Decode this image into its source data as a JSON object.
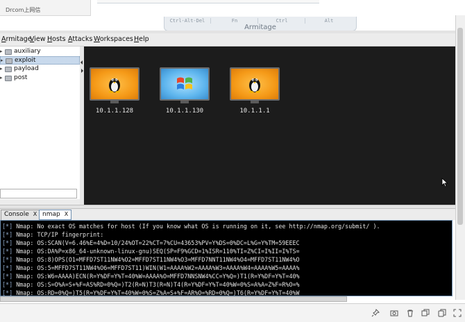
{
  "browser": {
    "tab_label": "Drcom上网信"
  },
  "kvm": {
    "buttons": [
      "Ctrl-Alt-Del",
      "Fn",
      "Ctrl",
      "Alt"
    ],
    "title": "Armitage"
  },
  "menu": {
    "items": [
      {
        "label": "Armitage",
        "ul": "A"
      },
      {
        "label": "View",
        "ul": "V"
      },
      {
        "label": "Hosts",
        "ul": "H"
      },
      {
        "label": "Attacks",
        "ul": "A"
      },
      {
        "label": "Workspaces",
        "ul": "W"
      },
      {
        "label": "Help",
        "ul": "H"
      }
    ]
  },
  "modules": {
    "items": [
      {
        "label": "auxiliary",
        "selected": false
      },
      {
        "label": "exploit",
        "selected": true
      },
      {
        "label": "payload",
        "selected": false
      },
      {
        "label": "post",
        "selected": false
      }
    ]
  },
  "hosts": [
    {
      "ip": "10.1.1.128",
      "os": "linux",
      "icon": "tux-icon"
    },
    {
      "ip": "10.1.1.130",
      "os": "windows",
      "icon": "windows-logo-icon"
    },
    {
      "ip": "10.1.1.1",
      "os": "linux",
      "icon": "tux-icon"
    }
  ],
  "tabs": [
    {
      "label": "Console",
      "close": "X",
      "active": false
    },
    {
      "label": "nmap",
      "close": "X",
      "active": true
    }
  ],
  "console": {
    "prefix": "[*]",
    "lines": [
      "Nmap: No exact OS matches for host (If you know what OS is running on it, see http://nmap.org/submit/ ).",
      "Nmap: TCP/IP fingerprint:",
      "Nmap: OS:SCAN(V=6.46%E=4%D=10/24%OT=22%CT=7%CU=43653%PV=Y%DS=0%DC=L%G=Y%TM=59EEEC",
      "Nmap: OS:DA%P=x86_64-unknown-linux-gnu)SEQ(SP=F9%GCD=1%ISR=110%TI=Z%CI=I%II=I%TS=",
      "Nmap: OS:8)OPS(O1=MFFD7ST11NW4%O2=MFFD7ST11NW4%O3=MFFD7NNT11NW4%O4=MFFD7ST11NW4%O",
      "Nmap: OS:5=MFFD7ST11NW4%O6=MFFD7ST11)WIN(W1=AAAA%W2=AAAA%W3=AAAA%W4=AAAA%W5=AAAA%",
      "Nmap: OS:W6=AAAA)ECN(R=Y%DF=Y%T=40%W=AAAA%O=MFFD7NNSNW4%CC=Y%Q=)T1(R=Y%DF=Y%T=40%",
      "Nmap: OS:S=O%A=S+%F=AS%RD=0%Q=)T2(R=N)T3(R=N)T4(R=Y%DF=Y%T=40%W=0%S=A%A=Z%F=R%O=%",
      "Nmap: OS:RD=0%Q=)T5(R=Y%DF=Y%T=40%W=0%S=Z%A=S+%F=AR%O=%RD=0%Q=)T6(R=Y%DF=Y%T=40%W"
    ]
  }
}
